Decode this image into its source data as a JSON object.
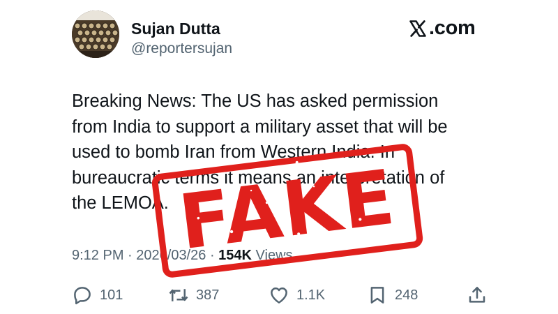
{
  "author": {
    "display_name": "Sujan Dutta",
    "handle": "@reportersujan",
    "avatar_icon": "typewriter-keys-avatar"
  },
  "brand": {
    "icon": "x-logo-icon",
    "text": ".com"
  },
  "tweet": {
    "lines": [
      "Breaking News: The US has asked permission",
      "from India to support a military asset that will be",
      "used to bomb Iran from Western India. In",
      "bureaucratic terms it means an interpretation of",
      "the LEMOA."
    ],
    "time": "9:12 PM",
    "date": "2026/03/26",
    "views_count": "154K",
    "views_label": "Views"
  },
  "actions": {
    "replies": {
      "icon": "reply-icon",
      "count": "101"
    },
    "reposts": {
      "icon": "repost-icon",
      "count": "387"
    },
    "likes": {
      "icon": "heart-icon",
      "count": "1.1K"
    },
    "bookmarks": {
      "icon": "bookmark-icon",
      "count": "248"
    },
    "share": {
      "icon": "share-icon"
    }
  },
  "stamp": {
    "text": "FAKE",
    "color": "#e0201c"
  },
  "colors": {
    "text_primary": "#0f1419",
    "text_secondary": "#536471"
  }
}
